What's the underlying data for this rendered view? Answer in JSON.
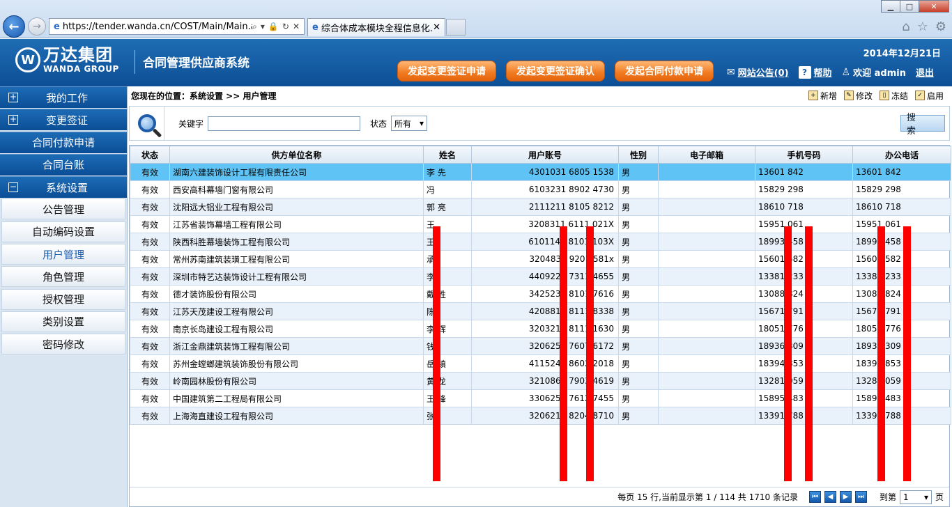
{
  "browser": {
    "url": "https://tender.wanda.cn/COST/Main/Main.a",
    "tab_title": "综合体成本模块全程信息化...",
    "win_min": "▁",
    "win_max": "□",
    "win_close": "✕"
  },
  "header": {
    "logo_cn": "万达集团",
    "logo_en": "WANDA GROUP",
    "system_title": "合同管理供应商系统",
    "date": "2014年12月21日",
    "buttons": [
      "发起变更签证申请",
      "发起变更签证确认",
      "发起合同付款申请"
    ],
    "notice": "网站公告(0)",
    "help": "帮助",
    "welcome": "欢迎 admin",
    "logout": "退出"
  },
  "sidebar": {
    "menus": [
      {
        "label": "我的工作",
        "box": "+"
      },
      {
        "label": "变更签证",
        "box": "+"
      },
      {
        "label": "合同付款申请",
        "box": ""
      },
      {
        "label": "合同台账",
        "box": ""
      },
      {
        "label": "系统设置",
        "box": "−"
      }
    ],
    "subs": [
      "公告管理",
      "自动编码设置",
      "用户管理",
      "角色管理",
      "授权管理",
      "类别设置",
      "密码修改"
    ],
    "active_sub": "用户管理"
  },
  "breadcrumb": "您现在的位置：系统设置 >> 用户管理",
  "actions": [
    "新增",
    "修改",
    "冻结",
    "启用"
  ],
  "search": {
    "keyword_label": "关键字",
    "keyword_value": "",
    "state_label": "状态",
    "state_value": "所有",
    "button": "搜 索"
  },
  "table": {
    "headers": [
      "状态",
      "供方单位名称",
      "姓名",
      "用户账号",
      "性别",
      "电子邮箱",
      "手机号码",
      "办公电话"
    ],
    "rows": [
      [
        "有效",
        "湖南六建装饰设计工程有限责任公司",
        "李  先",
        "4301031  6805  1538",
        "男",
        "",
        "13601  842",
        "13601  842"
      ],
      [
        "有效",
        "西安高科幕墙门窗有限公司",
        "冯  ",
        "6103231  8902  4730",
        "男",
        "",
        "15829  298",
        "15829  298"
      ],
      [
        "有效",
        "沈阳远大铝业工程有限公司",
        "郭  亮",
        "2111211  8105  8212",
        "男",
        "",
        "18610  718",
        "18610  718"
      ],
      [
        "有效",
        "江苏省装饰幕墙工程有限公司",
        "王  ",
        "3208311  6111  021X",
        "男",
        "",
        "15951  061",
        "15951  061"
      ],
      [
        "有效",
        "陕西科胜幕墙装饰工程有限公司",
        "王  ",
        "6101141  8101  103X",
        "男",
        "",
        "18993  458",
        "18993  458"
      ],
      [
        "有效",
        "常州苏南建筑装璜工程有限公司",
        "承  ",
        "3204831  9201  581x",
        "男",
        "",
        "15601  582",
        "15601  582"
      ],
      [
        "有效",
        "深圳市特艺达装饰设计工程有限公司",
        "李  ",
        "4409221  7311  4655",
        "男",
        "",
        "13381  233",
        "13381  233"
      ],
      [
        "有效",
        "德才装饰股份有限公司",
        "戴  胜",
        "3425231  8101  7616",
        "男",
        "",
        "13088  824",
        "13088  824"
      ],
      [
        "有效",
        "江苏天茂建设工程有限公司",
        "陈  ",
        "4208811  8111  8338",
        "男",
        "",
        "15671  791",
        "15671  791"
      ],
      [
        "有效",
        "南京长岛建设工程有限公司",
        "李  辉",
        "3203211  8111  1630",
        "男",
        "",
        "18051  776",
        "18051  776"
      ],
      [
        "有效",
        "浙江金鼎建筑装饰工程有限公司",
        "钱  ",
        "3206251  7607  6172",
        "男",
        "",
        "18936  309",
        "18936  309"
      ],
      [
        "有效",
        "苏州金螳螂建筑装饰股份有限公司",
        "岳  镇",
        "4115241  8602  2018",
        "男",
        "",
        "18394  853",
        "18394  853"
      ],
      [
        "有效",
        "岭南园林股份有限公司",
        "黄  龙",
        "3210861  7903  4619",
        "男",
        "",
        "13281  059",
        "13281  059"
      ],
      [
        "有效",
        "中国建筑第二工程局有限公司",
        "王  锋",
        "3306251  7612  7455",
        "男",
        "",
        "15895  483",
        "15895  483"
      ],
      [
        "有效",
        "上海海直建设工程有限公司",
        "张  ",
        "3206211  8204  8710",
        "男",
        "",
        "13391  788",
        "13391  788"
      ]
    ]
  },
  "pager": {
    "summary": "每页 15 行,当前显示第 1 / 114 共 1710 条记录",
    "goto_label": "到第",
    "page_value": "1",
    "page_unit": "页"
  },
  "colors": {
    "header_blue": "#1f6db4",
    "orange": "#f07a1f",
    "selected_row": "#5fc4f5",
    "redaction": "#ff0000"
  }
}
